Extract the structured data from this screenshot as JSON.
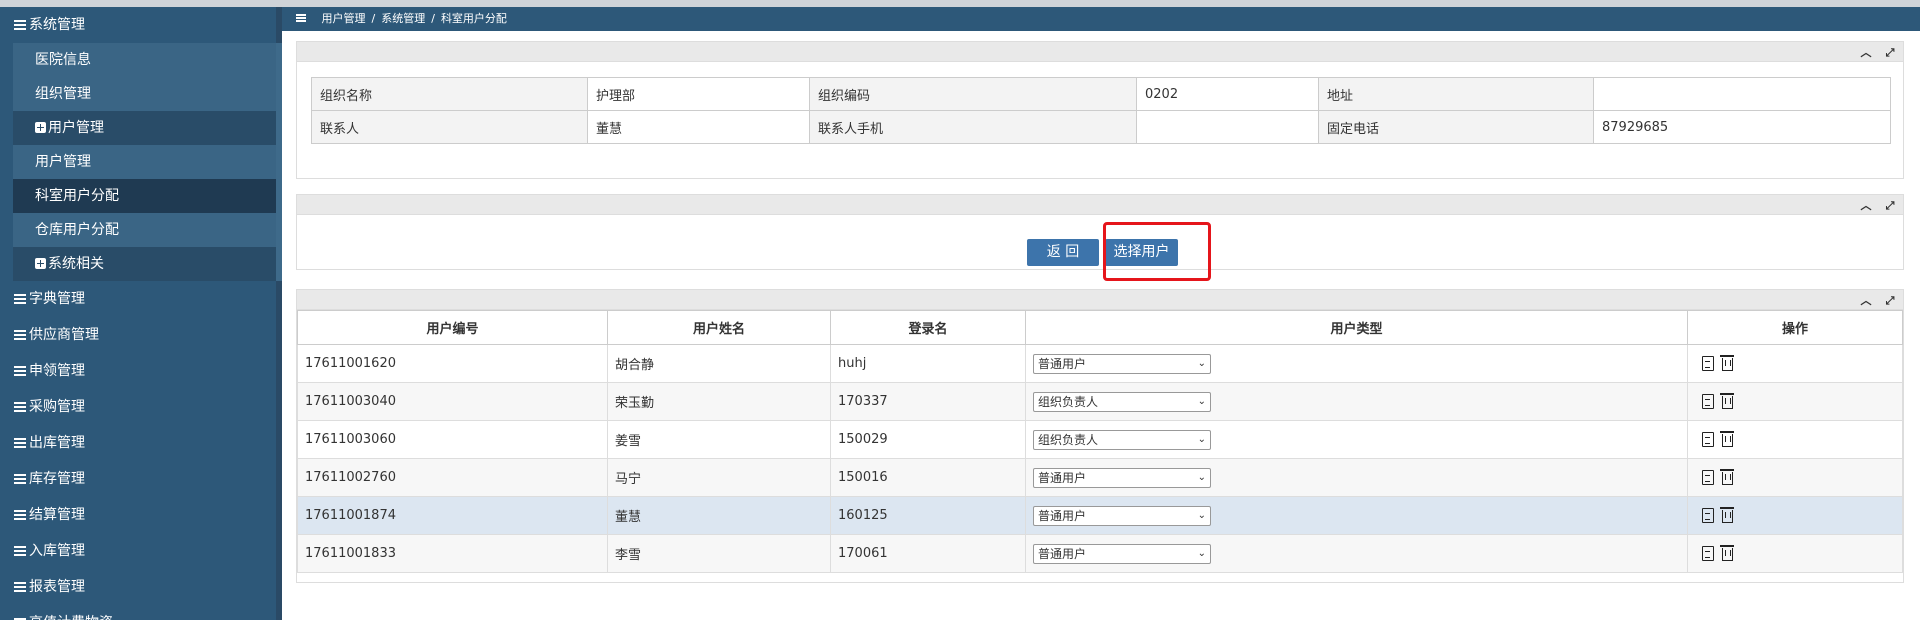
{
  "sidebar": {
    "items": [
      {
        "label": "系统管理",
        "type": "top"
      },
      {
        "label": "医院信息",
        "type": "sub"
      },
      {
        "label": "组织管理",
        "type": "sub"
      },
      {
        "label": "用户管理",
        "type": "group"
      },
      {
        "label": "用户管理",
        "type": "sub"
      },
      {
        "label": "科室用户分配",
        "type": "active"
      },
      {
        "label": "仓库用户分配",
        "type": "sub"
      },
      {
        "label": "系统相关",
        "type": "group"
      },
      {
        "label": "字典管理",
        "type": "top"
      },
      {
        "label": "供应商管理",
        "type": "top"
      },
      {
        "label": "申领管理",
        "type": "top"
      },
      {
        "label": "采购管理",
        "type": "top"
      },
      {
        "label": "出库管理",
        "type": "top"
      },
      {
        "label": "库存管理",
        "type": "top"
      },
      {
        "label": "结算管理",
        "type": "top"
      },
      {
        "label": "入库管理",
        "type": "top"
      },
      {
        "label": "报表管理",
        "type": "top"
      },
      {
        "label": "高值计费物资",
        "type": "top"
      }
    ]
  },
  "breadcrumb": [
    "用户管理",
    "系统管理",
    "科室用户分配"
  ],
  "org_info": {
    "row1": {
      "name_label": "组织名称",
      "name_value": "护理部",
      "code_label": "组织编码",
      "code_value": "0202",
      "addr_label": "地址",
      "addr_value": ""
    },
    "row2": {
      "contact_label": "联系人",
      "contact_value": "董慧",
      "mobile_label": "联系人手机",
      "mobile_value": "",
      "phone_label": "固定电话",
      "phone_value": "87929685"
    }
  },
  "actions": {
    "back_label": "返 回",
    "select_user_label": "选择用户"
  },
  "user_table": {
    "headers": [
      "用户编号",
      "用户姓名",
      "登录名",
      "用户类型",
      "操作"
    ],
    "rows": [
      {
        "id": "17611001620",
        "name": "胡合静",
        "login": "huhj",
        "type": "普通用户"
      },
      {
        "id": "17611003040",
        "name": "荣玉勤",
        "login": "170337",
        "type": "组织负责人"
      },
      {
        "id": "17611003060",
        "name": "姜雪",
        "login": "150029",
        "type": "组织负责人"
      },
      {
        "id": "17611002760",
        "name": "马宁",
        "login": "150016",
        "type": "普通用户"
      },
      {
        "id": "17611001874",
        "name": "董慧",
        "login": "160125",
        "type": "普通用户"
      },
      {
        "id": "17611001833",
        "name": "李雪",
        "login": "170061",
        "type": "普通用户"
      }
    ]
  },
  "colors": {
    "sidebar_bg": "#2d5879",
    "button_bg": "#3d74ab",
    "highlight": "#e5151b",
    "selected_row": "#dce6f1"
  }
}
